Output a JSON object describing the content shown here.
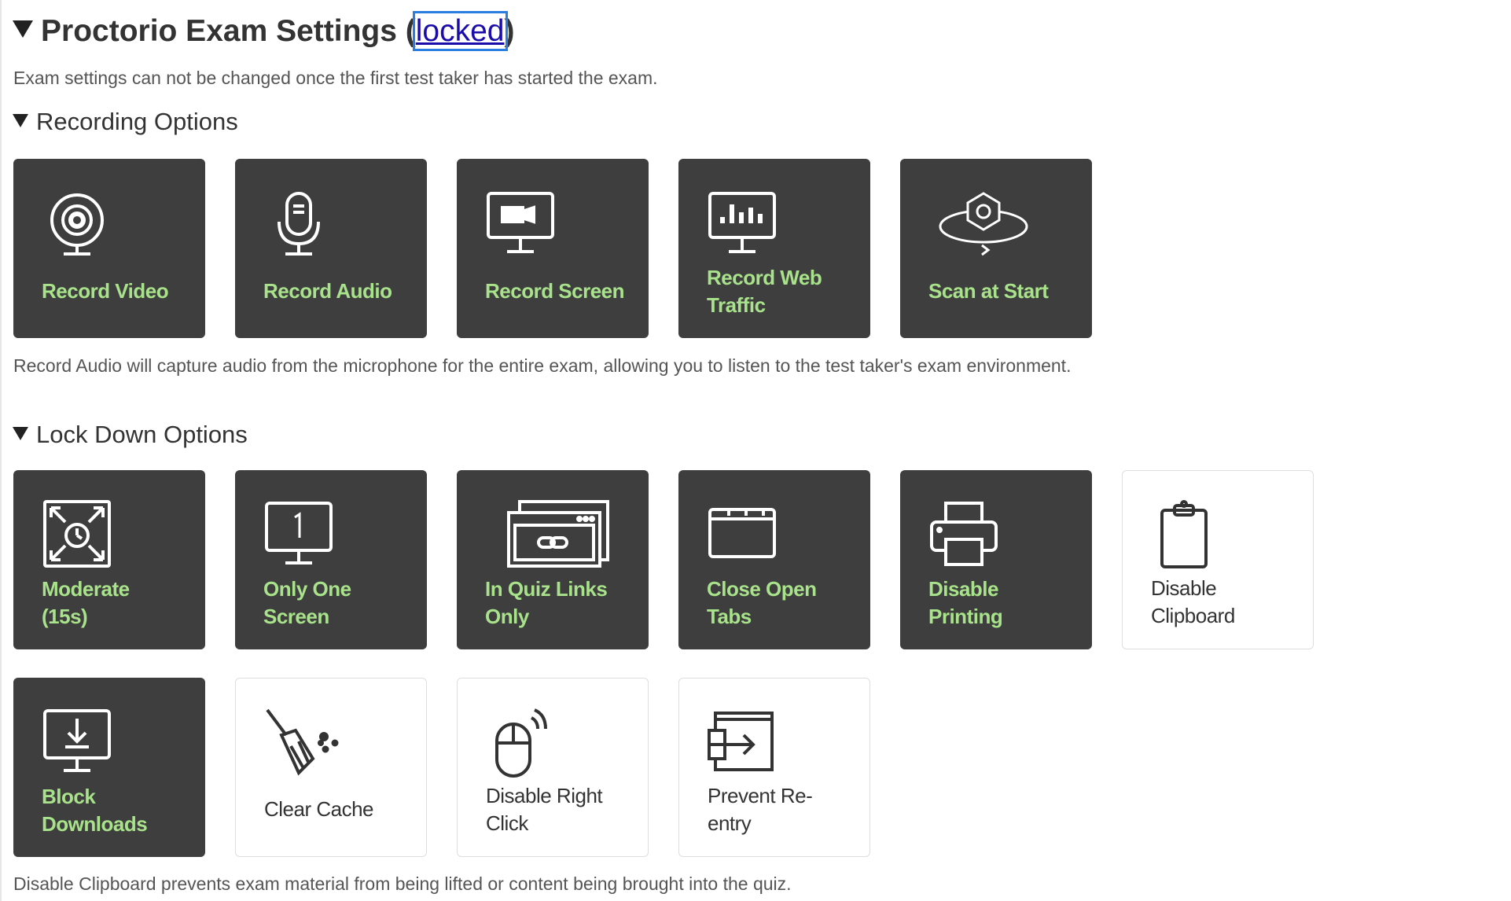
{
  "header": {
    "title_prefix": "Proctorio Exam Settings (",
    "lock_link": "locked",
    "title_suffix": ")",
    "description": "Exam settings can not be changed once the first test taker has started the exam."
  },
  "recording": {
    "heading": "Recording Options",
    "tiles": [
      {
        "label_1": "Record Video",
        "label_2": "",
        "icon": "webcam-icon",
        "enabled": true
      },
      {
        "label_1": "Record Audio",
        "label_2": "",
        "icon": "microphone-icon",
        "enabled": true
      },
      {
        "label_1": "Record Screen",
        "label_2": "",
        "icon": "screen-record-icon",
        "enabled": true
      },
      {
        "label_1": "Record Web",
        "label_2": "Traffic",
        "icon": "web-traffic-icon",
        "enabled": true
      },
      {
        "label_1": "Scan at Start",
        "label_2": "",
        "icon": "room-scan-icon",
        "enabled": true
      }
    ],
    "note": "Record Audio will capture audio from the microphone for the entire exam, allowing you to listen to the test taker's exam environment."
  },
  "lockdown": {
    "heading": "Lock Down Options",
    "tiles": [
      {
        "label_1": "Moderate",
        "label_2": "(15s)",
        "icon": "fullscreen-timer-icon",
        "enabled": true
      },
      {
        "label_1": "Only One",
        "label_2": "Screen",
        "icon": "single-monitor-icon",
        "enabled": true
      },
      {
        "label_1": "In Quiz Links",
        "label_2": "Only",
        "icon": "link-window-icon",
        "enabled": true
      },
      {
        "label_1": "Close Open",
        "label_2": "Tabs",
        "icon": "tabs-icon",
        "enabled": true
      },
      {
        "label_1": "Disable",
        "label_2": "Printing",
        "icon": "printer-icon",
        "enabled": true
      },
      {
        "label_1": "Disable",
        "label_2": "Clipboard",
        "icon": "clipboard-icon",
        "enabled": false
      },
      {
        "label_1": "Block",
        "label_2": "Downloads",
        "icon": "download-icon",
        "enabled": true
      },
      {
        "label_1": "Clear Cache",
        "label_2": "",
        "icon": "broom-icon",
        "enabled": false
      },
      {
        "label_1": "Disable Right",
        "label_2": "Click",
        "icon": "mouse-right-click-icon",
        "enabled": false
      },
      {
        "label_1": "Prevent Re-",
        "label_2": "entry",
        "icon": "reentry-icon",
        "enabled": false
      }
    ],
    "note": "Disable Clipboard prevents exam material from being lifted or content being brought into the quiz."
  },
  "colors": {
    "tile_on": "#3e3e3e",
    "label_on": "#a8e28a",
    "link": "#1a0dab"
  }
}
